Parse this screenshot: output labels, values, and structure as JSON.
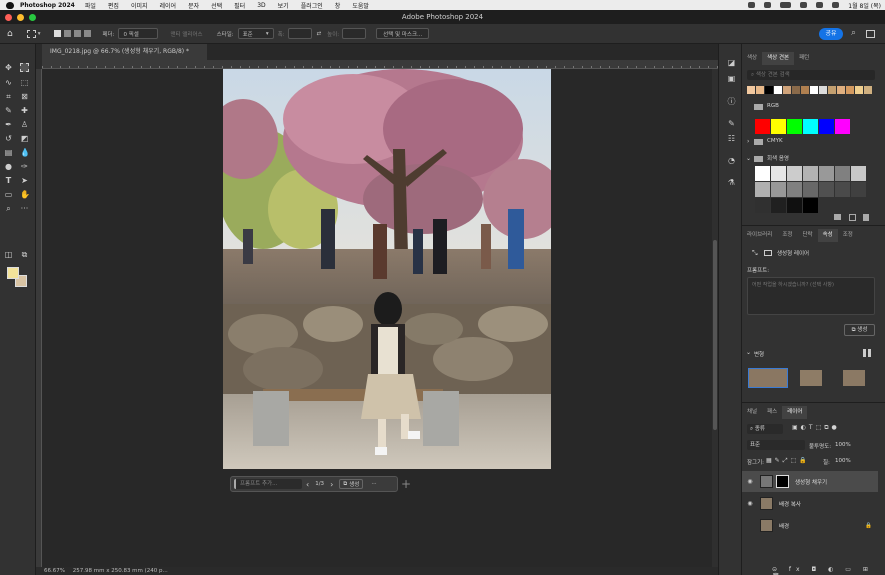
{
  "menubar": {
    "app_name": "Photoshop 2024",
    "items": [
      "파일",
      "편집",
      "이미지",
      "레이어",
      "문자",
      "선택",
      "필터",
      "3D",
      "보기",
      "플러그인",
      "창",
      "도움말"
    ],
    "clock": "1월 8일 (목)"
  },
  "window": {
    "title": "Adobe Photoshop 2024"
  },
  "options": {
    "feather_label": "페더:",
    "feather_value": "0 픽셀",
    "anti_alias": "앤티 앨리어스",
    "style_label": "스타일:",
    "style_value": "표준",
    "width_label": "폭:",
    "height_label": "높이:",
    "select_mask": "선택 및 마스크...",
    "share": "공유"
  },
  "document": {
    "tab": "IMG_0218.jpg @ 66.7% (생성형 채우기, RGB/8) *"
  },
  "taskbar": {
    "prompt_placeholder": "프롬프트 추가...",
    "pager": "1/3",
    "generate": "생성",
    "more": "···"
  },
  "status": {
    "zoom": "66.67%",
    "dims": "257.98 mm x 250.83 mm (240 p..."
  },
  "swatches_panel": {
    "tabs": [
      "색상",
      "색상 견본",
      "패턴"
    ],
    "active_tab": "색상 견본",
    "search_placeholder": "색상 견본 검색",
    "recent": [
      "#f2c9a0",
      "#e8b98a",
      "#000000",
      "#ffffff",
      "#cfa37a",
      "#8a6a4a",
      "#b08050",
      "#ffffff",
      "#dcdcdc",
      "#c4a070",
      "#e0b080",
      "#d49a60",
      "#f0d090",
      "#d0b080"
    ],
    "groups": [
      {
        "name": "RGB",
        "colors": [
          "#ff0000",
          "#ffff00",
          "#00ff00",
          "#00ffff",
          "#0000ff",
          "#ff00ff"
        ]
      },
      {
        "name": "CMYK"
      },
      {
        "name": "회색 음영",
        "colors": [
          "#ffffff",
          "#e6e6e6",
          "#cccccc",
          "#b3b3b3",
          "#999999",
          "#808080",
          "#c8c8c8",
          "#b0b0b0",
          "#989898",
          "#808080",
          "#686868",
          "#505050",
          "#4a4a4a",
          "#404040",
          "#303030",
          "#202020",
          "#101010",
          "#000000"
        ]
      }
    ]
  },
  "properties_panel": {
    "tabs": [
      "라이브러리",
      "조정",
      "단락",
      "속성",
      "조정"
    ],
    "active_tab": "속성",
    "layer_type": "생성형 레이어",
    "prompt_label": "프롬프트:",
    "prompt_placeholder": "어떤 작업을 하시겠습니까? (선택 사항)",
    "generate_button": "생성",
    "variations_label": "변형"
  },
  "layers_panel": {
    "tabs": [
      "채널",
      "패스",
      "레이어"
    ],
    "active_tab": "레이어",
    "kind_filter": "종류",
    "blend_mode": "표준",
    "opacity_label": "불투명도:",
    "opacity": "100%",
    "lock_label": "잠그기:",
    "fill_label": "칠:",
    "fill": "100%",
    "layers": [
      {
        "name": "생성형 채우기",
        "active": true
      },
      {
        "name": "배경 복사",
        "active": false
      },
      {
        "name": "배경",
        "active": false
      }
    ]
  }
}
